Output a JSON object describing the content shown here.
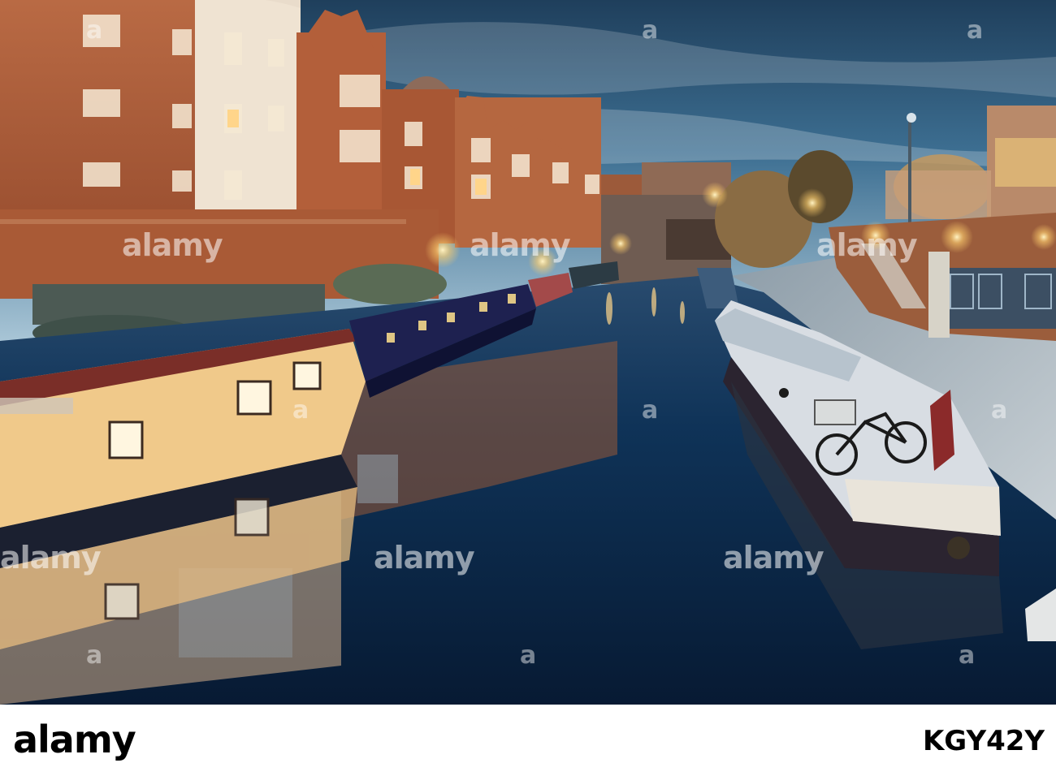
{
  "photo": {
    "subject": "canal-with-narrowboats-at-dusk",
    "colors": {
      "sky_top": "#1f3f5c",
      "sky_mid": "#3d6f92",
      "sky_low": "#9fc0d4",
      "brick": "#b8623a",
      "water": "#0c2a4a",
      "lamp": "#ffd27a"
    }
  },
  "watermark": {
    "text": "alamy",
    "symbol": "a"
  },
  "footer": {
    "logo": "alamy",
    "image_id": "KGY42Y"
  }
}
